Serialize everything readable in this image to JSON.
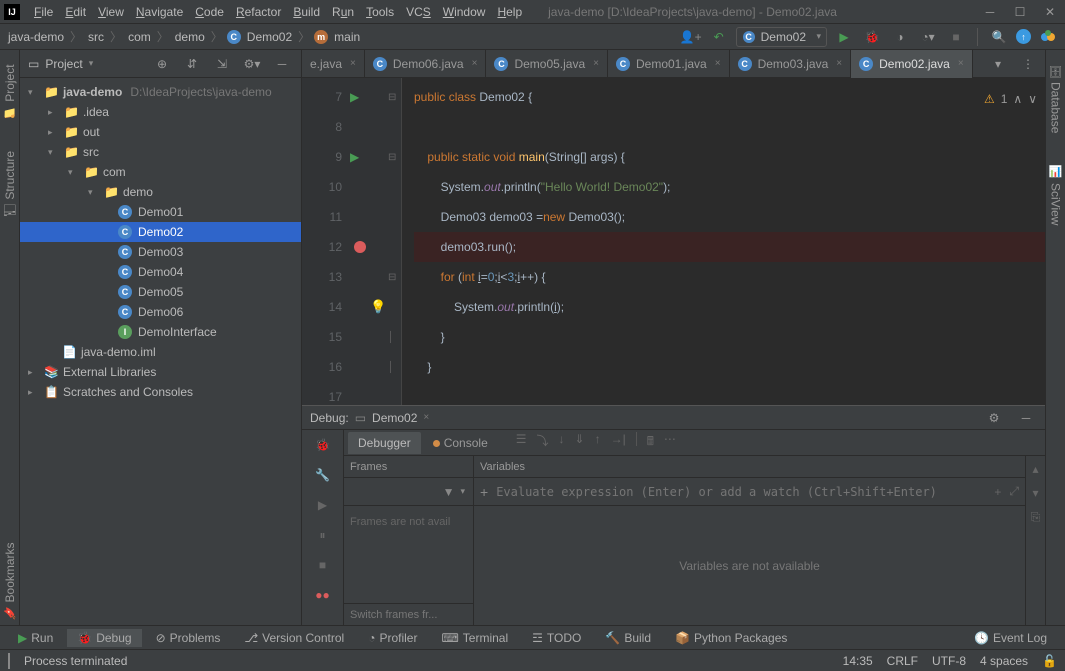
{
  "title": "java-demo [D:\\IdeaProjects\\java-demo] - Demo02.java",
  "menu": [
    "File",
    "Edit",
    "View",
    "Navigate",
    "Code",
    "Refactor",
    "Build",
    "Run",
    "Tools",
    "VCS",
    "Window",
    "Help"
  ],
  "breadcrumb": {
    "root": "java-demo",
    "items": [
      "src",
      "com",
      "demo"
    ],
    "class": "Demo02",
    "method": "main"
  },
  "runConfig": "Demo02",
  "leftTabs": [
    "Project",
    "Structure",
    "Bookmarks"
  ],
  "rightTabs": [
    "Database",
    "SciView"
  ],
  "projectHeader": "Project",
  "tree": {
    "root": {
      "name": "java-demo",
      "path": "D:\\IdeaProjects\\java-demo"
    },
    "idea": ".idea",
    "out": "out",
    "src": "src",
    "com": "com",
    "demo": "demo",
    "files": [
      "Demo01",
      "Demo02",
      "Demo03",
      "Demo04",
      "Demo05",
      "Demo06",
      "DemoInterface"
    ],
    "iml": "java-demo.iml",
    "ext": "External Libraries",
    "scratches": "Scratches and Consoles"
  },
  "tabs": [
    {
      "name": "e.java",
      "short": true
    },
    {
      "name": "Demo06.java"
    },
    {
      "name": "Demo05.java"
    },
    {
      "name": "Demo01.java"
    },
    {
      "name": "Demo03.java"
    },
    {
      "name": "Demo02.java",
      "active": true
    }
  ],
  "warnCount": "1",
  "code": {
    "l7": {
      "pre": "public class ",
      "cls": "Demo02",
      " post": " {"
    },
    "l9": {
      "pre": "public static void ",
      "mth": "main",
      "args": "(String[] args) {"
    },
    "l10": {
      "sys": "System",
      "out": ".out.",
      "pr": "println",
      "str": "(\"Hello World! Demo02\");"
    },
    "l11": {
      "a": "Demo03 demo03 = ",
      "nw": "new ",
      "b": "Demo03();"
    },
    "l12": "demo03.run();",
    "l13": {
      "f": "for ",
      "p": "(",
      "i": "int ",
      "v": "i",
      " a": " = ",
      "z": "0",
      "b": "; ",
      "v2": "i",
      "c": " < ",
      "t": "3",
      "d": "; ",
      "v3": "i",
      "e": "++) {"
    },
    "l14": {
      "sys": "System",
      "out": ".out.",
      "pr": "println",
      "args": "(",
      "v": "i",
      "end": ");"
    },
    "l15": "}",
    "l16": "}",
    "l17": ""
  },
  "lineNums": [
    "7",
    "8",
    "9",
    "10",
    "11",
    "12",
    "13",
    "14",
    "15",
    "16",
    "17"
  ],
  "debug": {
    "title": "Debug:",
    "config": "Demo02",
    "tabs": {
      "debugger": "Debugger",
      "console": "Console"
    },
    "frames": {
      "title": "Frames",
      "empty": "Frames are not avail",
      "footer": "Switch frames fr..."
    },
    "vars": {
      "title": "Variables",
      "placeholder": "Evaluate expression (Enter) or add a watch (Ctrl+Shift+Enter)",
      "empty": "Variables are not available"
    }
  },
  "toolWindows": {
    "run": "Run",
    "debug": "Debug",
    "problems": "Problems",
    "vc": "Version Control",
    "profiler": "Profiler",
    "terminal": "Terminal",
    "todo": "TODO",
    "build": "Build",
    "python": "Python Packages",
    "eventlog": "Event Log"
  },
  "status": {
    "msg": "Process terminated",
    "pos": "14:35",
    "le": "CRLF",
    "enc": "UTF-8",
    "indent": "4 spaces"
  }
}
